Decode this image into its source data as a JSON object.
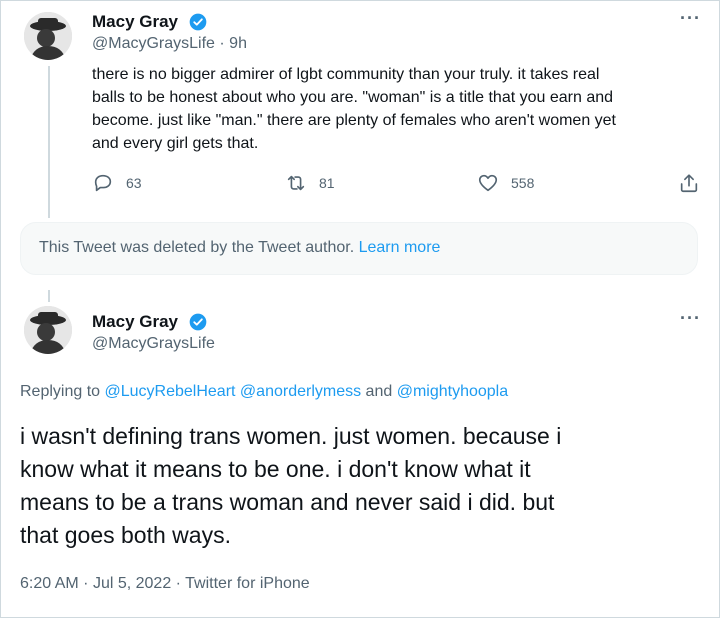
{
  "tweet1": {
    "name": "Macy Gray",
    "handle": "@MacyGraysLife",
    "time": "9h",
    "text_lines": [
      "there is no bigger admirer of lgbt community than your truly.  it takes real",
      "balls to be honest about who you are.  \"woman\" is a title that you earn and",
      "become.  just like \"man.\" there are plenty of females who aren't women yet",
      "and every girl gets that."
    ],
    "actions": {
      "replies": "63",
      "retweets": "81",
      "likes": "558"
    },
    "more": "···"
  },
  "deleted_notice": {
    "text": "This Tweet was deleted by the Tweet author.",
    "link": "Learn more"
  },
  "tweet2": {
    "name": "Macy Gray",
    "handle": "@MacyGraysLife",
    "more": "···",
    "replying_prefix": "Replying to",
    "replying_to": [
      "@LucyRebelHeart",
      "@anorderlymess",
      "@mightyhoopla"
    ],
    "replying_and": "and",
    "text_lines": [
      "i wasn't defining trans women. just women.  because i",
      "know what it means to be one. i don't know what it",
      "means to be a trans woman and never said i did.  but",
      "that goes both ways."
    ],
    "timestamp": "6:20 AM",
    "date": "Jul 5, 2022",
    "source": "Twitter for iPhone"
  },
  "colors": {
    "accent": "#1d9bf0",
    "secondary": "#536471"
  }
}
